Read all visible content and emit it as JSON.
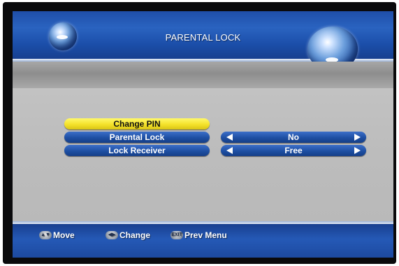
{
  "header": {
    "title": "PARENTAL LOCK"
  },
  "menu": {
    "items": [
      {
        "label": "Change PIN",
        "selected": true
      },
      {
        "label": "Parental Lock",
        "value": "No"
      },
      {
        "label": "Lock Receiver",
        "value": "Free"
      }
    ]
  },
  "footer": {
    "hints": [
      {
        "icon": "up-down-arrows-icon",
        "label": "Move"
      },
      {
        "icon": "left-right-arrows-icon",
        "label": "Change"
      },
      {
        "icon": "exit-button-icon",
        "label": "Prev Menu"
      }
    ]
  },
  "colors": {
    "header_blue": "#2a63c0",
    "selected_yellow": "#f4e22a",
    "pill_blue": "#1e4fa3",
    "body_gray": "#bdbdbd"
  }
}
